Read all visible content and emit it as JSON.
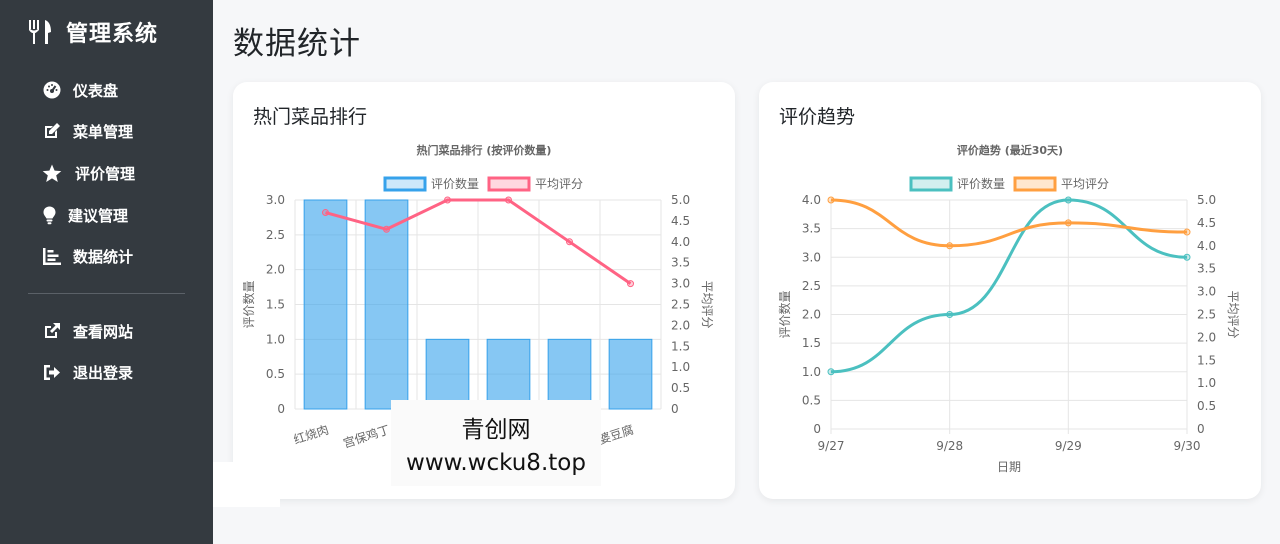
{
  "app": {
    "title": "管理系统"
  },
  "sidebar": {
    "items": [
      {
        "label": "仪表盘",
        "icon": "tachometer-icon"
      },
      {
        "label": "菜单管理",
        "icon": "edit-icon"
      },
      {
        "label": "评价管理",
        "icon": "star-icon"
      },
      {
        "label": "建议管理",
        "icon": "lightbulb-icon"
      },
      {
        "label": "数据统计",
        "icon": "chart-icon"
      }
    ],
    "bottom_items": [
      {
        "label": "查看网站",
        "icon": "external-link-icon"
      },
      {
        "label": "退出登录",
        "icon": "sign-out-icon"
      }
    ]
  },
  "page": {
    "title": "数据统计"
  },
  "cards": {
    "left": {
      "title": "热门菜品排行"
    },
    "right": {
      "title": "评价趋势"
    }
  },
  "watermark": {
    "line1": "青创网",
    "line2": "www.wcku8.top"
  },
  "colors": {
    "sidebar_bg": "#343a40",
    "blue": "#36a2eb",
    "red": "#ff6384",
    "teal": "#4bc0c0",
    "orange": "#ff9f40"
  },
  "chart_data": [
    {
      "type": "bar",
      "title": "热门菜品排行 (按评价数量)",
      "categories": [
        "红烧肉",
        "宫保鸡丁",
        "",
        "",
        "",
        "麻婆豆腐"
      ],
      "series": [
        {
          "name": "评价数量",
          "values": [
            3,
            3,
            1,
            1,
            1,
            1
          ],
          "axis": "left",
          "type": "bar"
        },
        {
          "name": "平均评分",
          "values": [
            4.7,
            4.3,
            5.0,
            5.0,
            4.0,
            3.0
          ],
          "axis": "right",
          "type": "line"
        }
      ],
      "ylabel": "评价数量",
      "y2label": "平均评分",
      "ylim": [
        0,
        3
      ],
      "y2lim": [
        0,
        5
      ],
      "yticks": [
        "0",
        "0.5",
        "1.0",
        "1.5",
        "2.0",
        "2.5",
        "3.0"
      ],
      "y2ticks": [
        "0",
        "0.5",
        "1.0",
        "1.5",
        "2.0",
        "2.5",
        "3.0",
        "3.5",
        "4.0",
        "4.5",
        "5.0"
      ],
      "legend": "top",
      "grid": true
    },
    {
      "type": "line",
      "title": "评价趋势 (最近30天)",
      "x": [
        "9/27",
        "9/28",
        "9/29",
        "9/30"
      ],
      "series": [
        {
          "name": "评价数量",
          "values": [
            1,
            2,
            4,
            3
          ],
          "axis": "left"
        },
        {
          "name": "平均评分",
          "values": [
            5.0,
            4.0,
            4.5,
            4.3
          ],
          "axis": "right"
        }
      ],
      "xlabel": "日期",
      "ylabel": "评价数量",
      "y2label": "平均评分",
      "ylim": [
        0,
        4
      ],
      "y2lim": [
        0,
        5
      ],
      "yticks": [
        "0",
        "0.5",
        "1.0",
        "1.5",
        "2.0",
        "2.5",
        "3.0",
        "3.5",
        "4.0"
      ],
      "y2ticks": [
        "0",
        "0.5",
        "1.0",
        "1.5",
        "2.0",
        "2.5",
        "3.0",
        "3.5",
        "4.0",
        "4.5",
        "5.0"
      ],
      "legend": "top",
      "grid": true
    }
  ]
}
